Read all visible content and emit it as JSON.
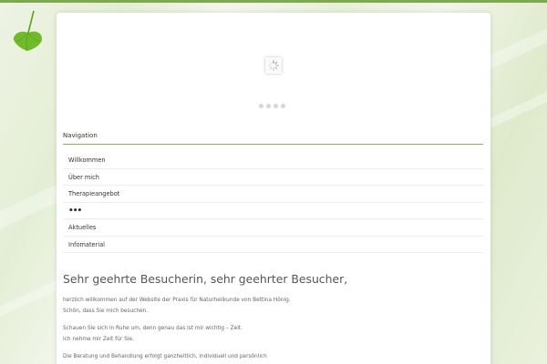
{
  "icons": {
    "leaf": "ginkgo-leaf-icon",
    "spinner": "loading-spinner-icon",
    "more": "more-dots-icon"
  },
  "colors": {
    "accent": "#8ab458",
    "leaf": "#6fbb2a",
    "text": "#333333"
  },
  "slider": {
    "dot_count": 4
  },
  "navigation": {
    "title": "Navigation",
    "items": [
      {
        "label": "Willkommen"
      },
      {
        "label": "Über mich"
      },
      {
        "label": "Therapieangebot"
      },
      {
        "label": "•••"
      },
      {
        "label": "Aktuelles"
      },
      {
        "label": "Infomaterial"
      }
    ]
  },
  "content": {
    "greeting": "Sehr geehrte Besucherin, sehr geehrter Besucher,",
    "paragraphs": [
      "herzlich willkommen auf der Website der Praxis für Naturheilkunde von Bettina Hönig.",
      "Schön, dass Sie mich besuchen.",
      "Schauen Sie sich in Ruhe um, denn genau das ist mir wichtig – Zeit.",
      "Ich nehme mir Zeit für Sie.",
      "Die Beratung und Behandlung erfolgt ganzheitlich, individuell und persönlich"
    ]
  }
}
